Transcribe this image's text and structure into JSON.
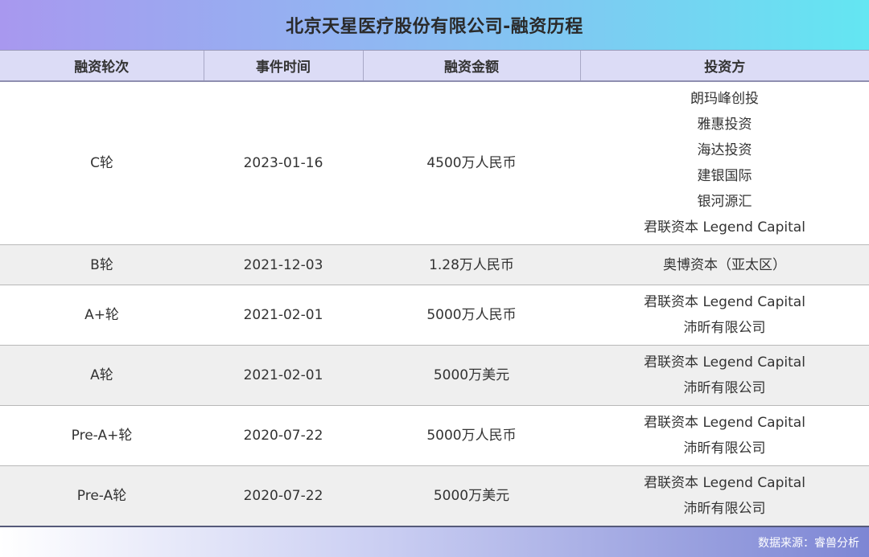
{
  "title": "北京天星医疗股份有限公司-融资历程",
  "headers": [
    "融资轮次",
    "事件时间",
    "融资金额",
    "投资方"
  ],
  "rows": [
    {
      "round": "C轮",
      "date": "2023-01-16",
      "amount": "4500万人民币",
      "investors": [
        "朗玛峰创投",
        "雅惠投资",
        "海达投资",
        "建银国际",
        "银河源汇",
        "君联资本 Legend Capital"
      ]
    },
    {
      "round": "B轮",
      "date": "2021-12-03",
      "amount": "1.28万人民币",
      "investors": [
        "奥博资本（亚太区）"
      ]
    },
    {
      "round": "A+轮",
      "date": "2021-02-01",
      "amount": "5000万人民币",
      "investors": [
        "君联资本 Legend Capital",
        "沛昕有限公司"
      ]
    },
    {
      "round": "A轮",
      "date": "2021-02-01",
      "amount": "5000万美元",
      "investors": [
        "君联资本 Legend Capital",
        "沛昕有限公司"
      ]
    },
    {
      "round": "Pre-A+轮",
      "date": "2020-07-22",
      "amount": "5000万人民币",
      "investors": [
        "君联资本 Legend Capital",
        "沛昕有限公司"
      ]
    },
    {
      "round": "Pre-A轮",
      "date": "2020-07-22",
      "amount": "5000万美元",
      "investors": [
        "君联资本 Legend Capital",
        "沛昕有限公司"
      ]
    }
  ],
  "source": "数据来源：睿兽分析"
}
